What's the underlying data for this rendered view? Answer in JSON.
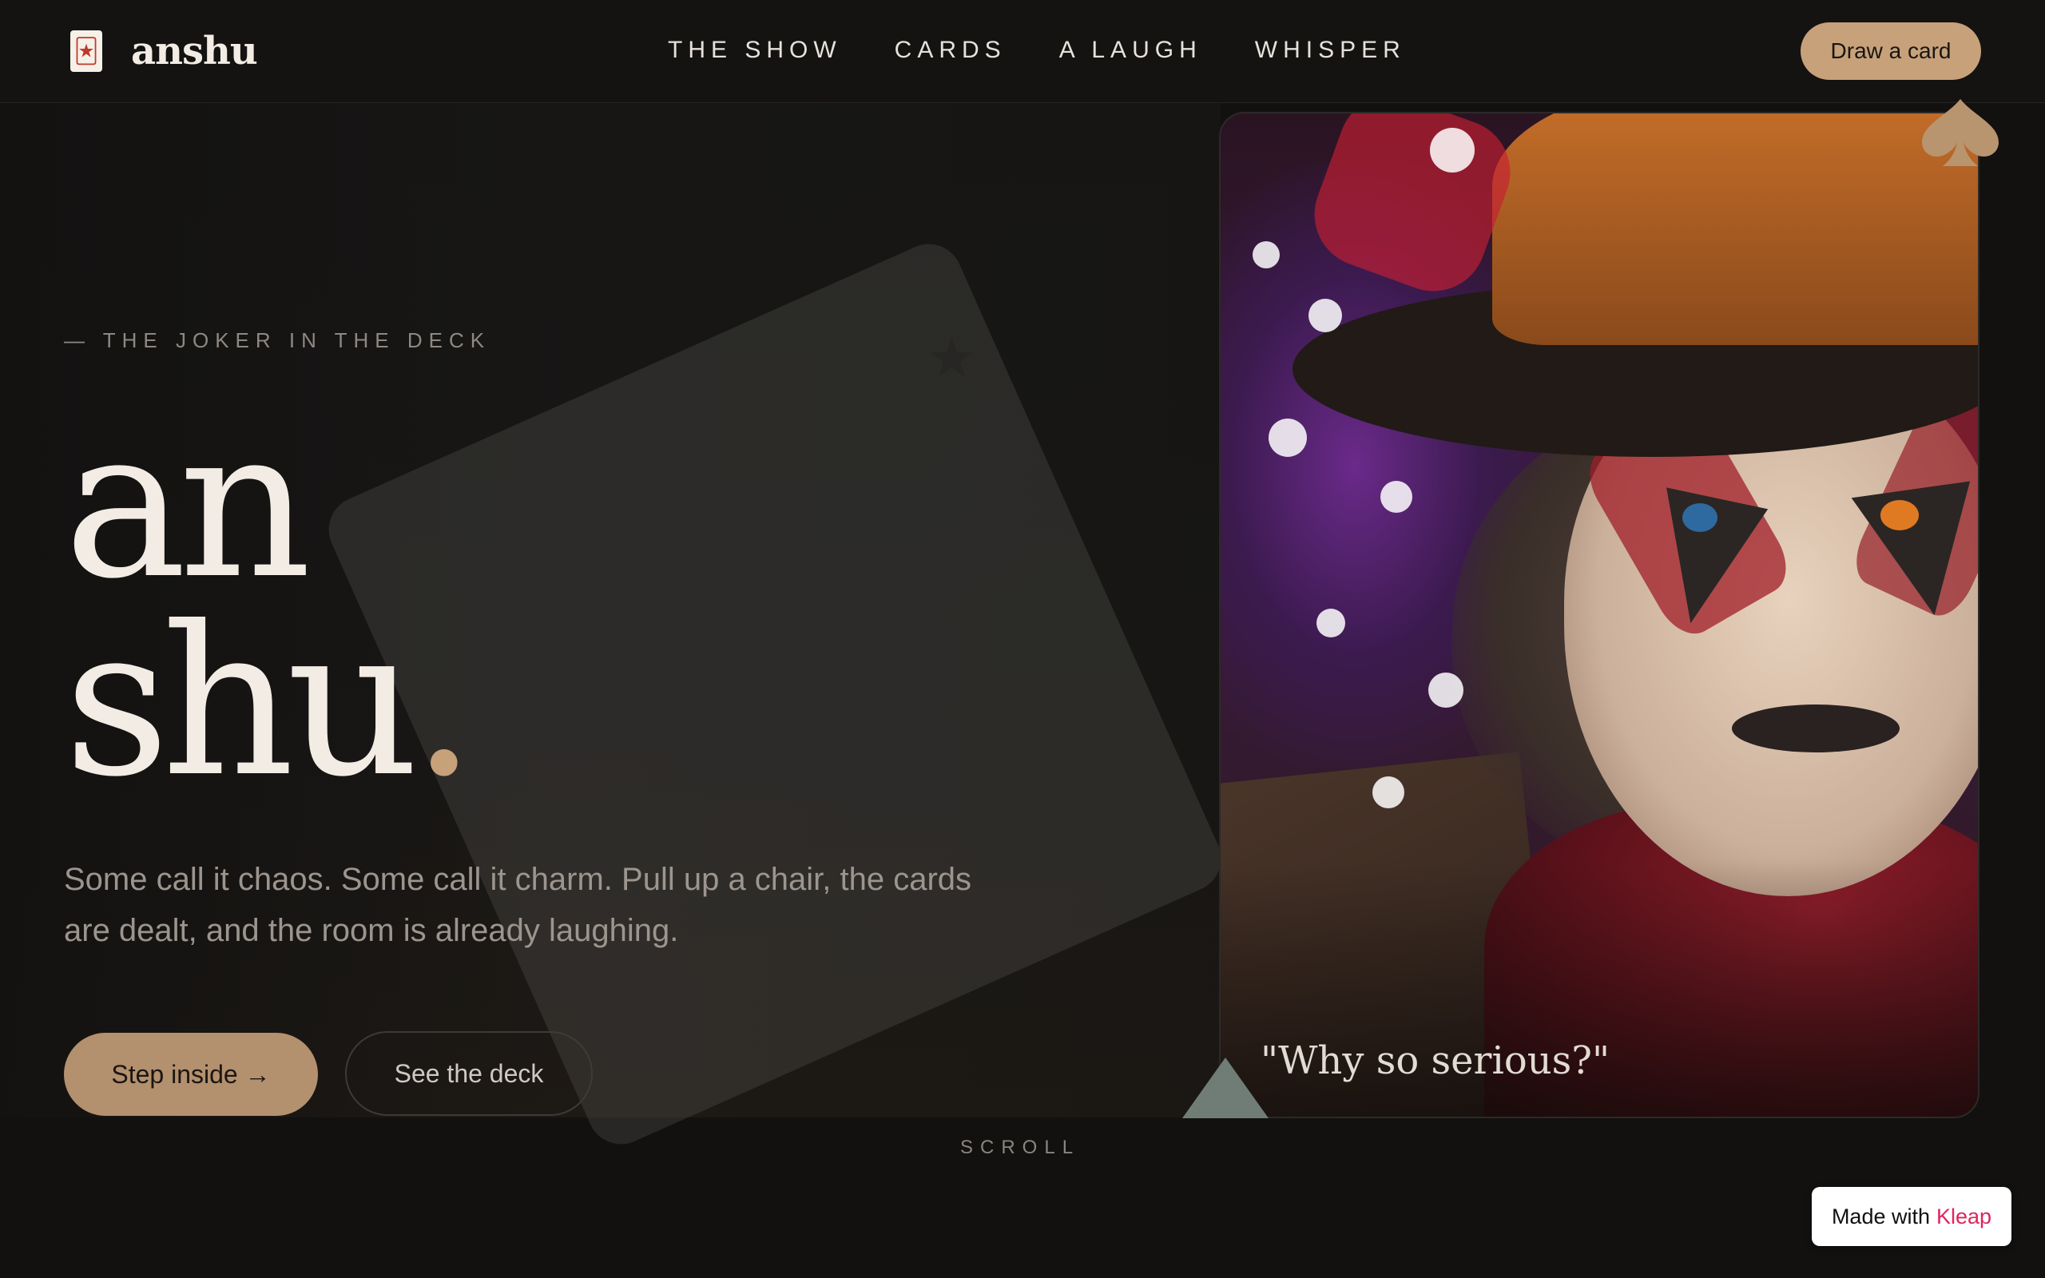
{
  "nav": {
    "brand_icon": "🃏",
    "brand_name": "anshu",
    "links": [
      "THE SHOW",
      "CARDS",
      "A LAUGH",
      "WHISPER"
    ],
    "cta_label": "Draw a card"
  },
  "hero": {
    "eyebrow": "— THE JOKER IN THE DECK",
    "headline_line1": "an",
    "headline_line2": "shu",
    "headline_dot": ".",
    "tagline": "Some call it chaos. Some call it charm. Pull up a chair, the cards are dealt, and the room is already laughing.",
    "primary_button": "Step inside →",
    "secondary_button": "See the deck",
    "scroll_label": "SCROLL"
  },
  "photo": {
    "quote": "\"Why so serious?\""
  },
  "badge": {
    "prefix": "Made with",
    "brand": "Kleap"
  },
  "colors": {
    "accent": "#c7a17a",
    "background": "#121110",
    "badge_brand": "#e0245e"
  },
  "icons": {
    "brand": "joker-card-icon",
    "decor": "spade-icon",
    "triangle": "triangle-decor"
  }
}
